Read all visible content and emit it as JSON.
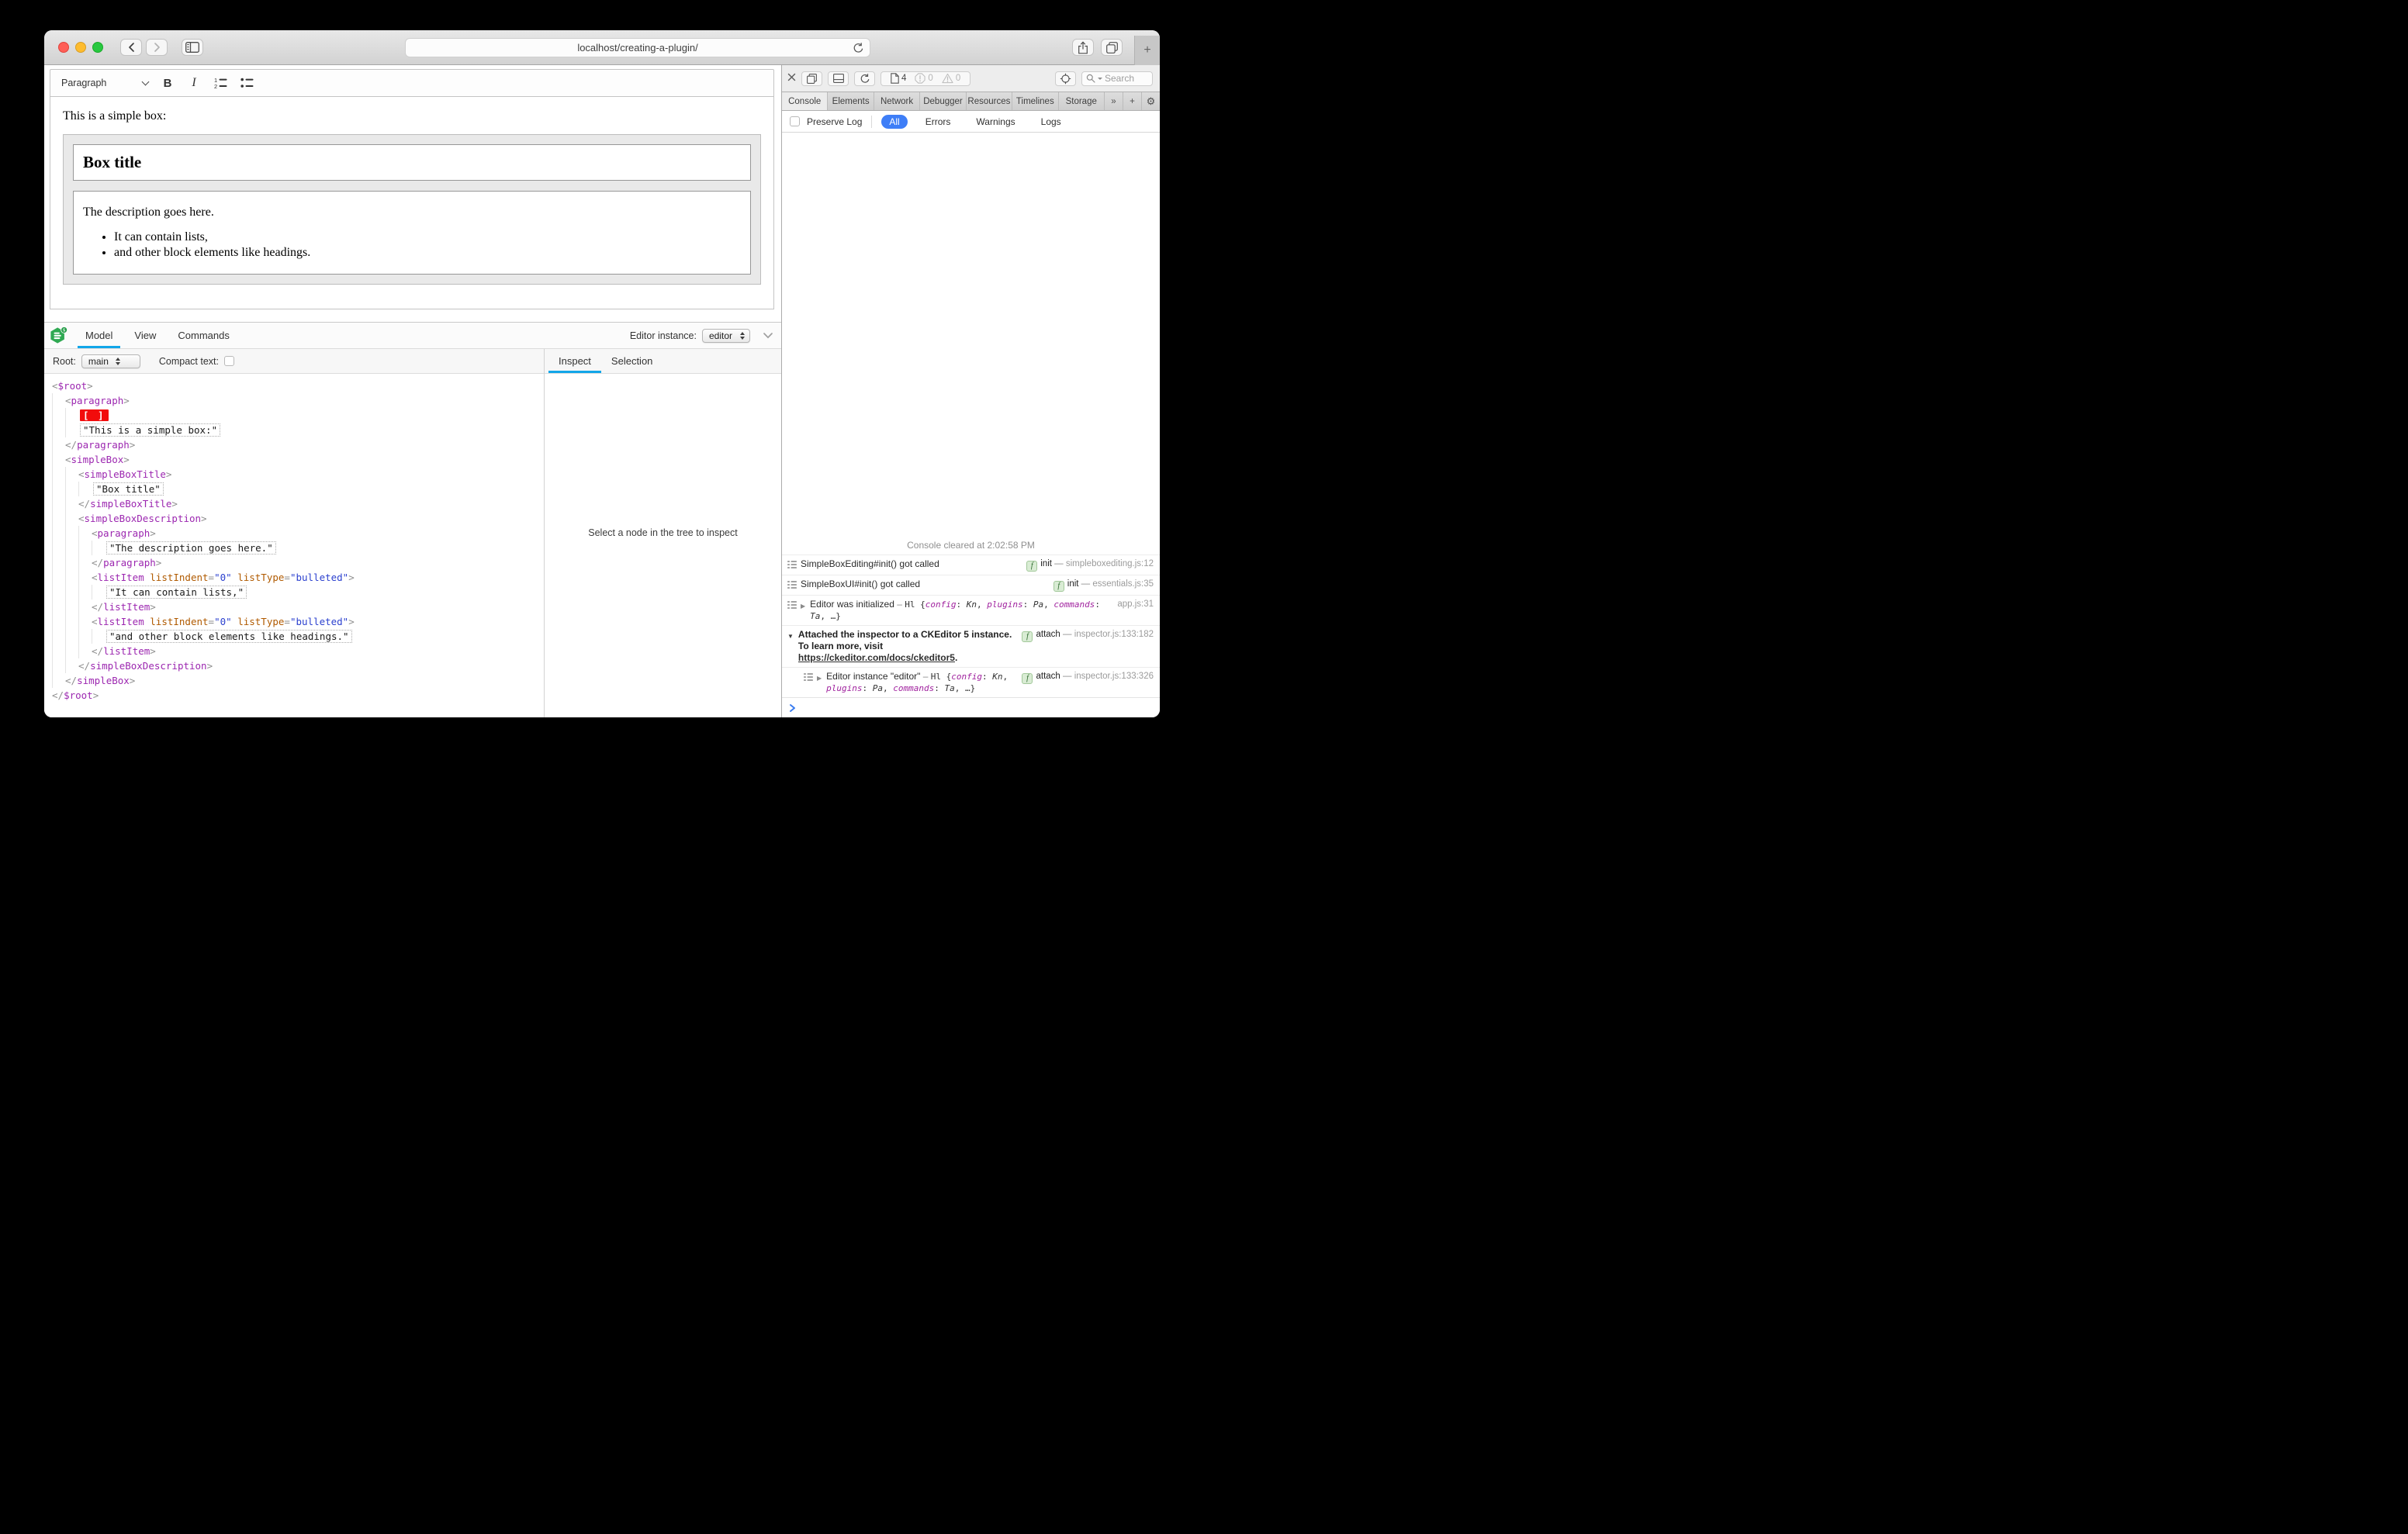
{
  "browser": {
    "url": "localhost/creating-a-plugin/",
    "new_tab_glyph": "+"
  },
  "editor": {
    "toolbar": {
      "paragraph": "Paragraph",
      "bold_glyph": "B",
      "italic_glyph": "I"
    },
    "content": {
      "intro": "This is a simple box:",
      "box_title": "Box title",
      "description": "The description goes here.",
      "list": [
        "It can contain lists,",
        "and other block elements like headings."
      ]
    }
  },
  "ck": {
    "tabs": [
      {
        "label": "Model",
        "active": true
      },
      {
        "label": "View"
      },
      {
        "label": "Commands"
      }
    ],
    "editor_instance_label": "Editor instance:",
    "editor_instance_value": "editor",
    "root_label": "Root:",
    "root_value": "main",
    "compact_label": "Compact text:",
    "side_tabs": [
      {
        "label": "Inspect",
        "active": true
      },
      {
        "label": "Selection"
      }
    ],
    "empty_message": "Select a node in the tree to inspect",
    "logo_badge": "5",
    "tree": [
      {
        "t": "open",
        "l": 0,
        "n": "$root"
      },
      {
        "t": "open",
        "l": 1,
        "n": "paragraph"
      },
      {
        "t": "sel",
        "l": 2,
        "text": "[ ]"
      },
      {
        "t": "text",
        "l": 2,
        "text": "\"This is a simple box:\""
      },
      {
        "t": "close",
        "l": 1,
        "n": "paragraph"
      },
      {
        "t": "open",
        "l": 1,
        "n": "simpleBox"
      },
      {
        "t": "open",
        "l": 2,
        "n": "simpleBoxTitle"
      },
      {
        "t": "text",
        "l": 3,
        "text": "\"Box title\""
      },
      {
        "t": "close",
        "l": 2,
        "n": "simpleBoxTitle"
      },
      {
        "t": "open",
        "l": 2,
        "n": "simpleBoxDescription"
      },
      {
        "t": "open",
        "l": 3,
        "n": "paragraph"
      },
      {
        "t": "text",
        "l": 4,
        "text": "\"The description goes here.\""
      },
      {
        "t": "close",
        "l": 3,
        "n": "paragraph"
      },
      {
        "t": "open",
        "l": 3,
        "n": "listItem",
        "attrs": [
          [
            "listIndent",
            "0"
          ],
          [
            "listType",
            "bulleted"
          ]
        ]
      },
      {
        "t": "text",
        "l": 4,
        "text": "\"It can contain lists,\""
      },
      {
        "t": "close",
        "l": 3,
        "n": "listItem"
      },
      {
        "t": "open",
        "l": 3,
        "n": "listItem",
        "attrs": [
          [
            "listIndent",
            "0"
          ],
          [
            "listType",
            "bulleted"
          ]
        ]
      },
      {
        "t": "text",
        "l": 4,
        "text": "\"and other block elements like headings.\""
      },
      {
        "t": "close",
        "l": 3,
        "n": "listItem"
      },
      {
        "t": "close",
        "l": 2,
        "n": "simpleBoxDescription"
      },
      {
        "t": "close",
        "l": 1,
        "n": "simpleBox"
      },
      {
        "t": "close",
        "l": 0,
        "n": "$root"
      }
    ]
  },
  "wi": {
    "toolbar": {
      "page_count": "4",
      "error_count": "0",
      "warning_count": "0",
      "search_placeholder": "Search"
    },
    "tabbar": {
      "overflow_glyph": "»",
      "add_glyph": "+",
      "settings_glyph": "⚙"
    },
    "tabs": [
      {
        "label": "Console",
        "active": true
      },
      {
        "label": "Elements"
      },
      {
        "label": "Network"
      },
      {
        "label": "Debugger"
      },
      {
        "label": "Resources"
      },
      {
        "label": "Timelines"
      },
      {
        "label": "Storage"
      }
    ],
    "filter": {
      "preserve": "Preserve Log",
      "pills": [
        {
          "label": "All",
          "active": true
        },
        {
          "label": "Errors"
        },
        {
          "label": "Warnings"
        },
        {
          "label": "Logs"
        }
      ]
    },
    "console": {
      "cleared": "Console cleared at 2:02:58 PM",
      "fn_badge": "f",
      "dash": "—",
      "messages": [
        {
          "text": "SimpleBoxEditing#init() got called",
          "fn": "init",
          "source": "simpleboxediting.js:12"
        },
        {
          "text": "SimpleBoxUI#init() got called",
          "fn": "init",
          "source": "essentials.js:35"
        },
        {
          "disclosure": true,
          "text": "Editor was initialized",
          "obj": {
            "cls": "Hl",
            "props": [
              [
                "config",
                "Kn"
              ],
              [
                "plugins",
                "Pa"
              ],
              [
                "commands",
                "Ta"
              ]
            ]
          },
          "source": "app.js:31"
        },
        {
          "bold": true,
          "open": true,
          "text": "Attached the inspector to a CKEditor 5 instance. To learn more, visit",
          "link": "https://ckeditor.com/docs/ckeditor5",
          "suffix": ".",
          "fn": "attach",
          "source": "inspector.js:133:182"
        },
        {
          "nested": true,
          "disclosure": true,
          "text": "Editor instance \"editor\"",
          "obj": {
            "cls": "Hl",
            "props": [
              [
                "config",
                "Kn"
              ],
              [
                "plugins",
                "Pa"
              ],
              [
                "commands",
                "Ta"
              ]
            ]
          },
          "fn": "attach",
          "source": "inspector.js:133:326"
        }
      ]
    }
  }
}
